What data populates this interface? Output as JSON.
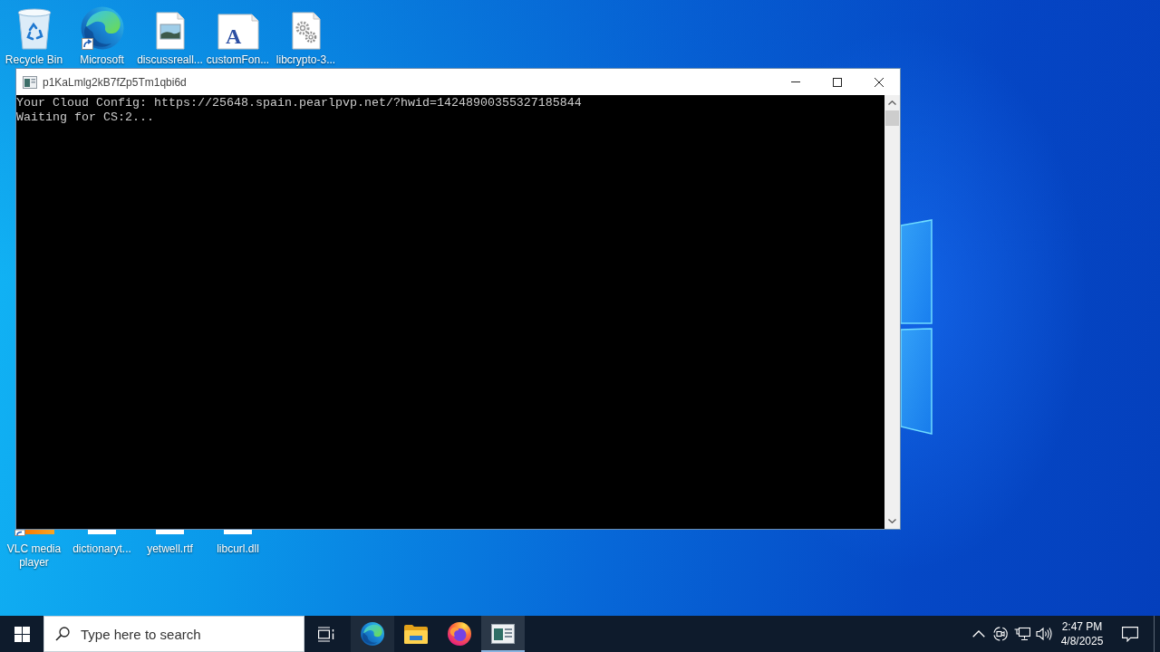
{
  "desktop": {
    "icons": [
      {
        "label": "Recycle Bin",
        "kind": "recycle-bin"
      },
      {
        "label": "Microsoft",
        "kind": "edge-shortcut"
      },
      {
        "label": "discussreall...",
        "kind": "image-file"
      },
      {
        "label": "customFon...",
        "kind": "font-file",
        "glyph": "A"
      },
      {
        "label": "libcrypto-3...",
        "kind": "dll-file"
      }
    ],
    "bottom_icons": [
      {
        "label": "VLC media player",
        "kind": "vlc-shortcut"
      },
      {
        "label": "dictionaryt...",
        "kind": "file"
      },
      {
        "label": "yetwell.rtf",
        "kind": "file"
      },
      {
        "label": "libcurl.dll",
        "kind": "file"
      }
    ]
  },
  "console_window": {
    "title": "p1KaLmlg2kB7fZp5Tm1qbi6d",
    "lines": [
      "Your Cloud Config: https://25648.spain.pearlpvp.net/?hwid=14248900355327185844",
      "Waiting for CS:2..."
    ]
  },
  "taskbar": {
    "search": {
      "placeholder": "Type here to search"
    },
    "apps": [
      {
        "kind": "edge",
        "highlighted": true,
        "selected": false
      },
      {
        "kind": "file-explorer",
        "highlighted": false,
        "selected": false
      },
      {
        "kind": "firefox",
        "highlighted": false,
        "selected": false
      },
      {
        "kind": "console",
        "highlighted": false,
        "selected": true
      }
    ],
    "clock": {
      "time": "2:47 PM",
      "date": "4/8/2025"
    }
  }
}
